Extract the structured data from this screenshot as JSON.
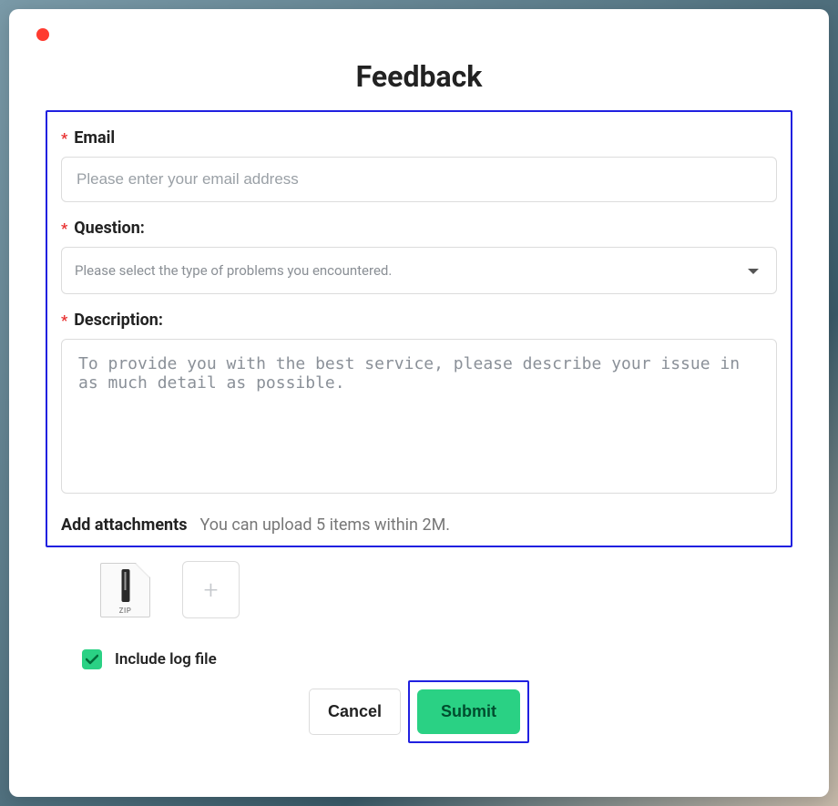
{
  "title": "Feedback",
  "fields": {
    "email": {
      "label": "Email",
      "placeholder": "Please enter your email address",
      "value": ""
    },
    "question": {
      "label": "Question:",
      "placeholder": "Please select the type of problems you encountered.",
      "value": ""
    },
    "description": {
      "label": "Description:",
      "placeholder": "To provide you with the best service, please describe your issue in as much detail as possible.",
      "value": ""
    }
  },
  "attachments": {
    "label": "Add attachments",
    "hint": "You can upload 5 items within 2M.",
    "items": [
      {
        "type": "zip",
        "badge": "ZIP"
      }
    ]
  },
  "include_log": {
    "label": "Include log file",
    "checked": true
  },
  "buttons": {
    "cancel": "Cancel",
    "submit": "Submit"
  },
  "colors": {
    "accent": "#2ad184",
    "required": "#e83030",
    "highlight": "#2020e0"
  }
}
